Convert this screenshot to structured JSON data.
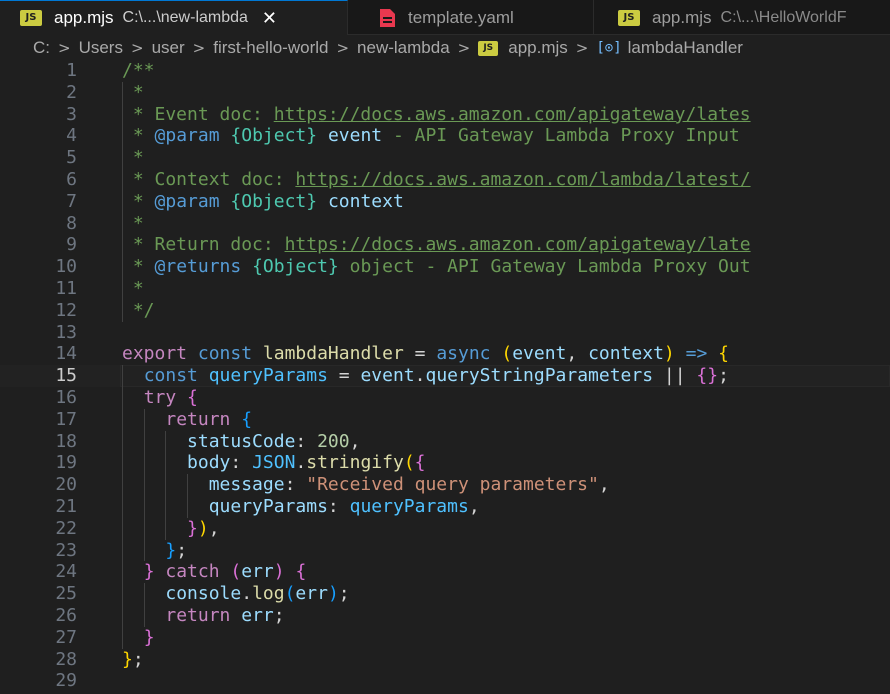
{
  "tabs": [
    {
      "icon": "JS",
      "name": "app.mjs",
      "desc": "C:\\...\\new-lambda",
      "close": "✕"
    },
    {
      "name": "template.yaml"
    },
    {
      "icon": "JS",
      "name": "app.mjs",
      "desc": "C:\\...\\HelloWorldF"
    }
  ],
  "breadcrumb": {
    "items": [
      "C:",
      "Users",
      "user",
      "first-hello-world",
      "new-lambda"
    ],
    "file_icon": "JS",
    "file": "app.mjs",
    "symbol": "lambdaHandler",
    "separator": ">"
  },
  "editor": {
    "current_line": 15,
    "lines": [
      {
        "n": "1",
        "t": [
          [
            "c",
            "/**"
          ]
        ]
      },
      {
        "n": "2",
        "t": [
          [
            "c",
            " *"
          ]
        ]
      },
      {
        "n": "3",
        "t": [
          [
            "c",
            " * Event doc: "
          ],
          [
            "u",
            "https://docs.aws.amazon.com/apigateway/lates"
          ]
        ]
      },
      {
        "n": "4",
        "t": [
          [
            "c",
            " * "
          ],
          [
            "k",
            "@param"
          ],
          [
            "c",
            " "
          ],
          [
            "t",
            "{Object}"
          ],
          [
            "c",
            " "
          ],
          [
            "v",
            "event"
          ],
          [
            "c",
            " - API Gateway Lambda Proxy Input"
          ]
        ]
      },
      {
        "n": "5",
        "t": [
          [
            "c",
            " *"
          ]
        ]
      },
      {
        "n": "6",
        "t": [
          [
            "c",
            " * Context doc: "
          ],
          [
            "u",
            "https://docs.aws.amazon.com/lambda/latest/"
          ]
        ]
      },
      {
        "n": "7",
        "t": [
          [
            "c",
            " * "
          ],
          [
            "k",
            "@param"
          ],
          [
            "c",
            " "
          ],
          [
            "t",
            "{Object}"
          ],
          [
            "c",
            " "
          ],
          [
            "v",
            "context"
          ]
        ]
      },
      {
        "n": "8",
        "t": [
          [
            "c",
            " *"
          ]
        ]
      },
      {
        "n": "9",
        "t": [
          [
            "c",
            " * Return doc: "
          ],
          [
            "u",
            "https://docs.aws.amazon.com/apigateway/late"
          ]
        ]
      },
      {
        "n": "10",
        "t": [
          [
            "c",
            " * "
          ],
          [
            "k",
            "@returns"
          ],
          [
            "c",
            " "
          ],
          [
            "t",
            "{Object}"
          ],
          [
            "c",
            " object - API Gateway Lambda Proxy Out"
          ]
        ]
      },
      {
        "n": "11",
        "t": [
          [
            "c",
            " *"
          ]
        ]
      },
      {
        "n": "12",
        "t": [
          [
            "c",
            " */"
          ]
        ]
      },
      {
        "n": "13",
        "t": []
      },
      {
        "n": "14",
        "t": [
          [
            "kc",
            "export"
          ],
          [
            "p",
            " "
          ],
          [
            "k",
            "const"
          ],
          [
            "p",
            " "
          ],
          [
            "f",
            "lambdaHandler"
          ],
          [
            "p",
            " = "
          ],
          [
            "k",
            "async"
          ],
          [
            "p",
            " "
          ],
          [
            "b1",
            "("
          ],
          [
            "v",
            "event"
          ],
          [
            "p",
            ", "
          ],
          [
            "v",
            "context"
          ],
          [
            "b1",
            ")"
          ],
          [
            "p",
            " "
          ],
          [
            "k",
            "=>"
          ],
          [
            "p",
            " "
          ],
          [
            "b1",
            "{"
          ]
        ]
      },
      {
        "n": "15",
        "t": [
          [
            "p",
            "  "
          ],
          [
            "k",
            "const"
          ],
          [
            "p",
            " "
          ],
          [
            "vc",
            "queryParams"
          ],
          [
            "p",
            " = "
          ],
          [
            "v",
            "event"
          ],
          [
            "p",
            "."
          ],
          [
            "v",
            "queryStringParameters"
          ],
          [
            "p",
            " || "
          ],
          [
            "b2",
            "{}"
          ],
          [
            "p",
            ";"
          ]
        ]
      },
      {
        "n": "16",
        "t": [
          [
            "p",
            "  "
          ],
          [
            "kc",
            "try"
          ],
          [
            "p",
            " "
          ],
          [
            "b2",
            "{"
          ]
        ]
      },
      {
        "n": "17",
        "t": [
          [
            "p",
            "    "
          ],
          [
            "kc",
            "return"
          ],
          [
            "p",
            " "
          ],
          [
            "b3",
            "{"
          ]
        ]
      },
      {
        "n": "18",
        "t": [
          [
            "p",
            "      "
          ],
          [
            "v",
            "statusCode"
          ],
          [
            "p",
            ": "
          ],
          [
            "n",
            "200"
          ],
          [
            "p",
            ","
          ]
        ]
      },
      {
        "n": "19",
        "t": [
          [
            "p",
            "      "
          ],
          [
            "v",
            "body"
          ],
          [
            "p",
            ": "
          ],
          [
            "vc",
            "JSON"
          ],
          [
            "p",
            "."
          ],
          [
            "f",
            "stringify"
          ],
          [
            "b1",
            "("
          ],
          [
            "b2",
            "{"
          ]
        ]
      },
      {
        "n": "20",
        "t": [
          [
            "p",
            "        "
          ],
          [
            "v",
            "message"
          ],
          [
            "p",
            ": "
          ],
          [
            "s",
            "\"Received query parameters\""
          ],
          [
            "p",
            ","
          ]
        ]
      },
      {
        "n": "21",
        "t": [
          [
            "p",
            "        "
          ],
          [
            "v",
            "queryParams"
          ],
          [
            "p",
            ": "
          ],
          [
            "vc",
            "queryParams"
          ],
          [
            "p",
            ","
          ]
        ]
      },
      {
        "n": "22",
        "t": [
          [
            "p",
            "      "
          ],
          [
            "b2",
            "}"
          ],
          [
            "b1",
            ")"
          ],
          [
            "p",
            ","
          ]
        ]
      },
      {
        "n": "23",
        "t": [
          [
            "p",
            "    "
          ],
          [
            "b3",
            "}"
          ],
          [
            "p",
            ";"
          ]
        ]
      },
      {
        "n": "24",
        "t": [
          [
            "p",
            "  "
          ],
          [
            "b2",
            "}"
          ],
          [
            "p",
            " "
          ],
          [
            "kc",
            "catch"
          ],
          [
            "p",
            " "
          ],
          [
            "b2",
            "("
          ],
          [
            "v",
            "err"
          ],
          [
            "b2",
            ")"
          ],
          [
            "p",
            " "
          ],
          [
            "b2",
            "{"
          ]
        ]
      },
      {
        "n": "25",
        "t": [
          [
            "p",
            "    "
          ],
          [
            "v",
            "console"
          ],
          [
            "p",
            "."
          ],
          [
            "f",
            "log"
          ],
          [
            "b3",
            "("
          ],
          [
            "v",
            "err"
          ],
          [
            "b3",
            ")"
          ],
          [
            "p",
            ";"
          ]
        ]
      },
      {
        "n": "26",
        "t": [
          [
            "p",
            "    "
          ],
          [
            "kc",
            "return"
          ],
          [
            "p",
            " "
          ],
          [
            "v",
            "err"
          ],
          [
            "p",
            ";"
          ]
        ]
      },
      {
        "n": "27",
        "t": [
          [
            "p",
            "  "
          ],
          [
            "b2",
            "}"
          ]
        ]
      },
      {
        "n": "28",
        "t": [
          [
            "b1",
            "}"
          ],
          [
            "p",
            ";"
          ]
        ]
      },
      {
        "n": "29",
        "t": []
      }
    ]
  }
}
